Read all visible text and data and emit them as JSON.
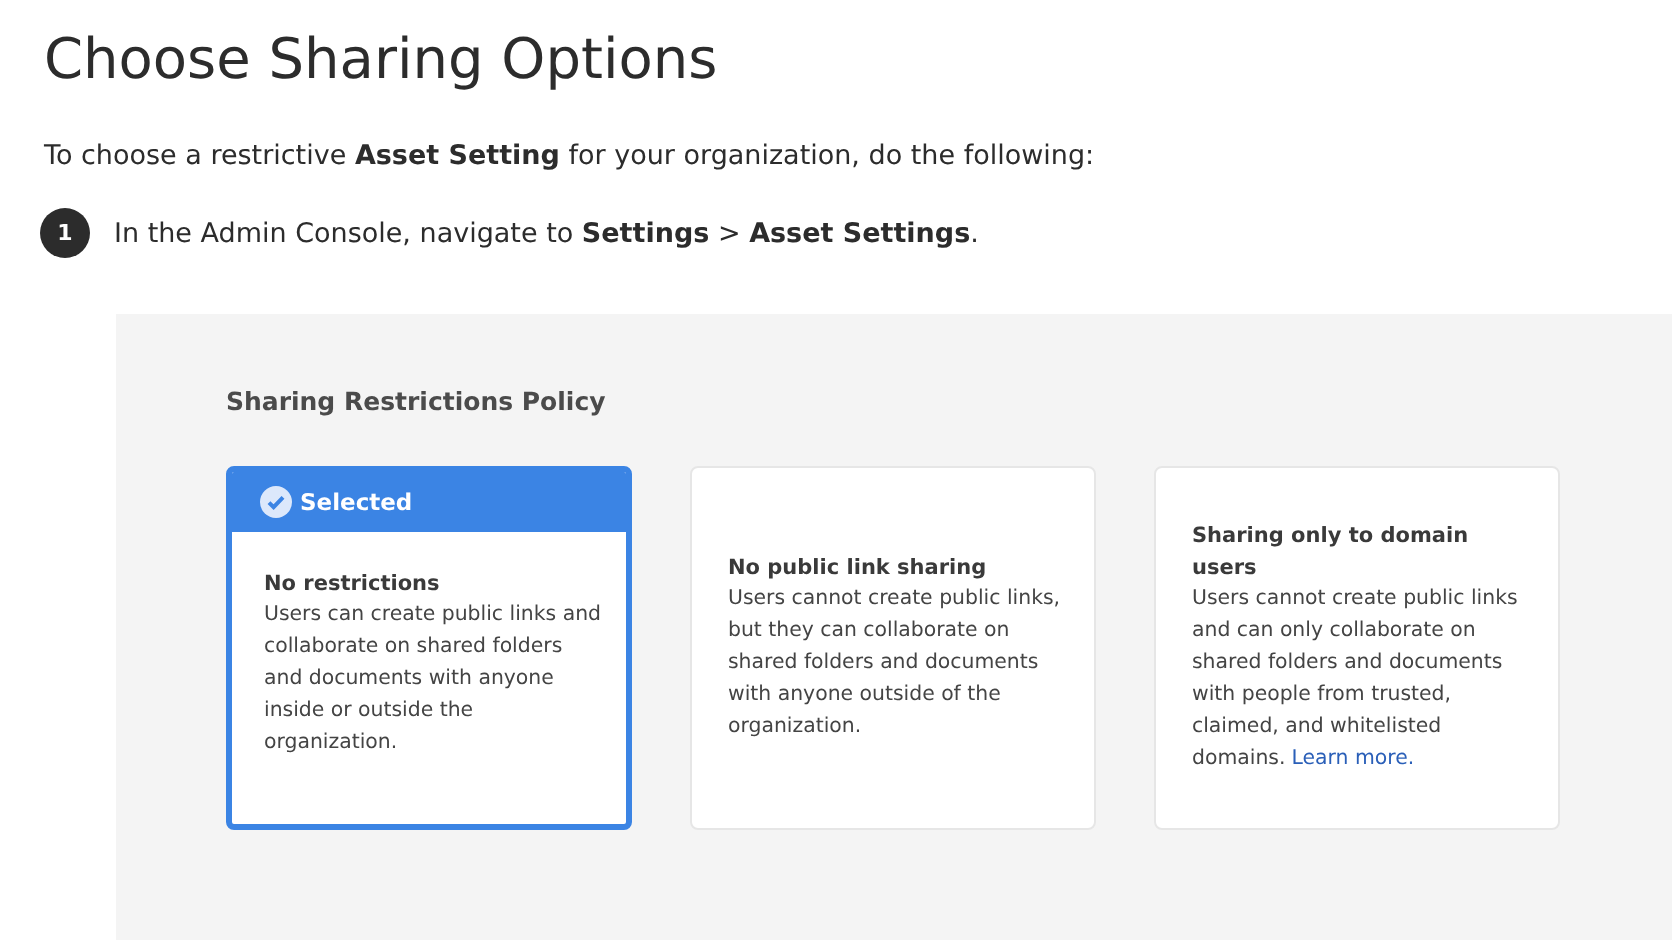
{
  "title": "Choose Sharing Options",
  "intro": "To choose a restrictive **Asset Setting** for your organization, do the following:",
  "steps": [
    {
      "number": "1",
      "text": "In the Admin Console, navigate to **Settings** > **Asset Settings**."
    }
  ],
  "panel": {
    "heading": "Sharing Restrictions Policy",
    "options": [
      {
        "selected": true,
        "badge": "Selected",
        "name": "No restrictions",
        "description": "Users can create public links and collaborate on shared folders and documents with anyone inside or outside the organization."
      },
      {
        "selected": false,
        "name": "No public link sharing",
        "description": "Users cannot create public links, but they can collaborate on shared folders and documents with anyone outside of the organization."
      },
      {
        "selected": false,
        "name": "Sharing only to domain users",
        "description": "Users cannot create public links and can only collaborate on shared folders and documents with people from trusted, claimed, and whitelisted domains.",
        "link": "Learn more."
      }
    ]
  }
}
